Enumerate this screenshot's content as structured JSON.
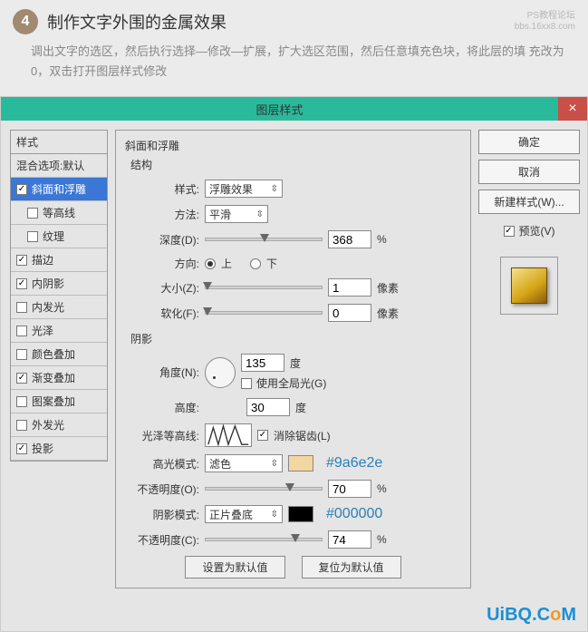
{
  "step": {
    "num": "4",
    "title": "制作文字外围的金属效果",
    "watermark1": "PS教程论坛",
    "watermark2": "bbs.16xx8.com",
    "desc": "调出文字的选区，然后执行选择—修改—扩展，扩大选区范围，然后任意填充色块，将此层的填 充改为0，双击打开图层样式修改"
  },
  "dlg": {
    "title": "图层样式",
    "close": "×"
  },
  "left": {
    "header": "样式",
    "blendopts": "混合选项:默认",
    "items": [
      "斜面和浮雕",
      "等高线",
      "纹理",
      "描边",
      "内阴影",
      "内发光",
      "光泽",
      "颜色叠加",
      "渐变叠加",
      "图案叠加",
      "外发光",
      "投影"
    ]
  },
  "bevel": {
    "legend": "斜面和浮雕",
    "structure": "结构",
    "style_lbl": "样式:",
    "style_val": "浮雕效果",
    "technique_lbl": "方法:",
    "technique_val": "平滑",
    "depth_lbl": "深度(D):",
    "depth_val": "368",
    "depth_unit": "%",
    "dir_lbl": "方向:",
    "up": "上",
    "down": "下",
    "size_lbl": "大小(Z):",
    "size_val": "1",
    "size_unit": "像素",
    "soften_lbl": "软化(F):",
    "soften_val": "0",
    "soften_unit": "像素"
  },
  "shading": {
    "legend": "阴影",
    "angle_lbl": "角度(N):",
    "angle_val": "135",
    "angle_unit": "度",
    "global_lbl": "使用全局光(G)",
    "alt_lbl": "高度:",
    "alt_val": "30",
    "alt_unit": "度",
    "gloss_lbl": "光泽等高线:",
    "aa_lbl": "消除锯齿(L)",
    "hi_lbl": "高光模式:",
    "hi_mode": "滤色",
    "hi_hex": "#9a6e2e",
    "hi_color": "#f3d6a0",
    "hi_op_lbl": "不透明度(O):",
    "hi_op_val": "70",
    "hi_op_unit": "%",
    "sh_lbl": "阴影模式:",
    "sh_mode": "正片叠底",
    "sh_hex": "#000000",
    "sh_color": "#000000",
    "sh_op_lbl": "不透明度(C):",
    "sh_op_val": "74",
    "sh_op_unit": "%"
  },
  "buttons": {
    "default": "设置为默认值",
    "reset": "复位为默认值"
  },
  "right": {
    "ok": "确定",
    "cancel": "取消",
    "newstyle": "新建样式(W)...",
    "preview": "预览(V)"
  },
  "brand": {
    "text1": "UiBQ.C",
    "text2": "M"
  }
}
